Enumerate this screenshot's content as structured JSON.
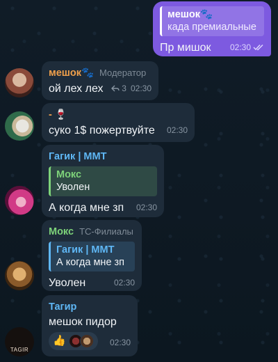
{
  "colors": {
    "outgoing_bubble": "#7d5ae0",
    "incoming_bubble": "#1e2c3a",
    "name_orange": "#f0a04b",
    "name_blue": "#5fb7f5",
    "name_green": "#7ed37a"
  },
  "messages": [
    {
      "direction": "out",
      "quote": {
        "name": "мешок🐾",
        "text": "када премиальные"
      },
      "text": "Пр мишок",
      "time": "02:30",
      "status_icon": "double-check-icon"
    },
    {
      "direction": "in",
      "sender": "мешок🐾",
      "role": "Модератор",
      "text": "ой лех лех",
      "replies": "3",
      "time": "02:30"
    },
    {
      "direction": "in",
      "sender": "- 🍷",
      "text": "суко 1$ пожертвуйте",
      "time": "02:30"
    },
    {
      "direction": "in",
      "sender": "Гагик | ММТ",
      "quote": {
        "name": "Мокс",
        "text": "Уволен"
      },
      "text": "А когда мне зп",
      "time": "02:30"
    },
    {
      "direction": "in",
      "sender": "Мокс",
      "role": "ТС-Филиалы",
      "quote": {
        "name": "Гагик | ММТ",
        "text": "А когда мне зп"
      },
      "text": "Уволен",
      "time": "02:30"
    },
    {
      "direction": "in",
      "sender": "Тагир",
      "text": "мешок пидор",
      "reaction": "👍",
      "time": "02:30",
      "avatar_label": "TAGIR"
    }
  ]
}
